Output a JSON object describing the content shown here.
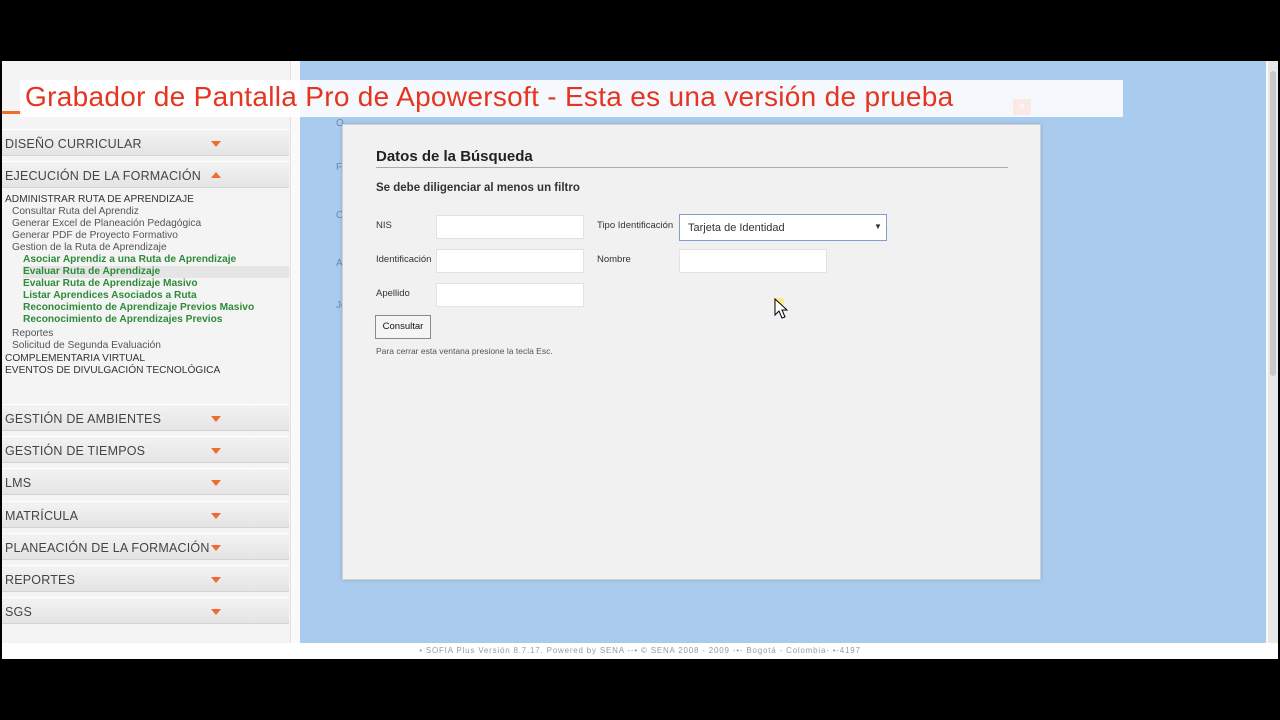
{
  "watermark": "Grabador de Pantalla Pro de Apowersoft  - Esta es una versión de prueba",
  "sidebar": {
    "sections_top": [
      {
        "label": "DISEÑO CURRICULAR",
        "expanded": false
      },
      {
        "label": "EJECUCIÓN DE LA FORMACIÓN",
        "expanded": true
      }
    ],
    "tree": [
      {
        "label": "ADMINISTRAR RUTA DE APRENDIZAJE",
        "level": 1
      },
      {
        "label": "Consultar Ruta del Aprendiz",
        "level": 2
      },
      {
        "label": "Generar Excel de Planeación Pedagógica",
        "level": 2
      },
      {
        "label": "Generar PDF de Proyecto Formativo",
        "level": 2
      },
      {
        "label": "Gestion de la Ruta de Aprendizaje",
        "level": 2
      },
      {
        "label": "Asociar Aprendiz a una Ruta de Aprendizaje",
        "level": 3
      },
      {
        "label": "Evaluar Ruta de Aprendizaje",
        "level": 3,
        "selected": true
      },
      {
        "label": "Evaluar Ruta de Aprendizaje Masivo",
        "level": 3
      },
      {
        "label": "Listar Aprendices Asociados a Ruta",
        "level": 3
      },
      {
        "label": "Reconocimiento de Aprendizaje Previos Masivo",
        "level": 3
      },
      {
        "label": "Reconocimiento de Aprendizajes Previos",
        "level": 3
      },
      {
        "label": "Reportes",
        "level": 2
      },
      {
        "label": "Solicitud de Segunda Evaluación",
        "level": 2
      },
      {
        "label": "COMPLEMENTARIA VIRTUAL",
        "level": 1
      },
      {
        "label": "EVENTOS DE DIVULGACIÓN TECNOLÓGICA",
        "level": 1
      }
    ],
    "sections_bottom": [
      {
        "label": "GESTIÓN DE AMBIENTES"
      },
      {
        "label": "GESTIÓN DE TIEMPOS"
      },
      {
        "label": "LMS"
      },
      {
        "label": "MATRÍCULA"
      },
      {
        "label": "PLANEACIÓN DE LA FORMACIÓN"
      },
      {
        "label": "REPORTES"
      },
      {
        "label": "SGS"
      }
    ]
  },
  "background_letters": [
    "O",
    "F",
    "C",
    "A",
    "Jo"
  ],
  "modal": {
    "title": "Datos de la Búsqueda",
    "subtitle": "Se debe diligenciar al menos un filtro",
    "fields": {
      "nis_label": "NIS",
      "nis_value": "",
      "tipo_label": "Tipo Identificación",
      "tipo_value": "Tarjeta de Identidad",
      "identificacion_label": "Identificación",
      "identificacion_value": "",
      "nombre_label": "Nombre",
      "nombre_value": "",
      "apellido_label": "Apellido",
      "apellido_value": ""
    },
    "button_label": "Consultar",
    "note": "Para cerrar esta ventana presione la tecla Esc.",
    "close_glyph": "×"
  },
  "footer": "• SOFIA Plus Versión 8.7.17. Powered by SENA --• © SENA 2008 - 2009 -•- Bogotá - Colombia- •-4197",
  "colors": {
    "accent": "#ef6c2a",
    "tree_link": "#2e8b3a",
    "main_bg": "#a9cbee",
    "watermark": "#e53420"
  }
}
